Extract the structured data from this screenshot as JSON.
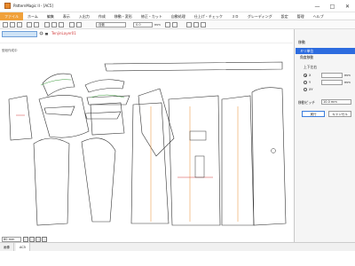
{
  "window": {
    "title": "PatternMagic II - [AC5]",
    "min_glyph": "—",
    "max_glyph": "□",
    "close_glyph": "✕"
  },
  "menu": [
    "ファイル",
    "ホーム",
    "編集",
    "表示",
    "入出力",
    "作成",
    "移動・変形",
    "修正・カット",
    "自動処理",
    "仕上げ・チェック",
    "３Ｄ",
    "グレーディング",
    "設定",
    "管理",
    "ヘルプ"
  ],
  "toolbar": {
    "combo_mode": "自動",
    "combo_value": "0.0",
    "combo_unit": "mm",
    "active_layer": "TenjinLayer01"
  },
  "canvas": {
    "label": "型紙作成中",
    "icons": [
      "pointer-icon",
      "move-icon",
      "ruler-icon",
      "pen-icon",
      "scissors-icon"
    ]
  },
  "status": {
    "zoom": "60 mm"
  },
  "tabs": [
    "画像",
    "AC5"
  ],
  "panel": {
    "title": "移動",
    "items": [
      "ミリ単位",
      "角度移動"
    ],
    "section_label": "上下左右",
    "radios": [
      "X",
      "Y",
      "XY"
    ],
    "unit": "mm",
    "offset_label": "移動ピッチ",
    "offset_value": "10.0 mm",
    "ok_label": "実行",
    "cancel_label": "キャンセル"
  }
}
